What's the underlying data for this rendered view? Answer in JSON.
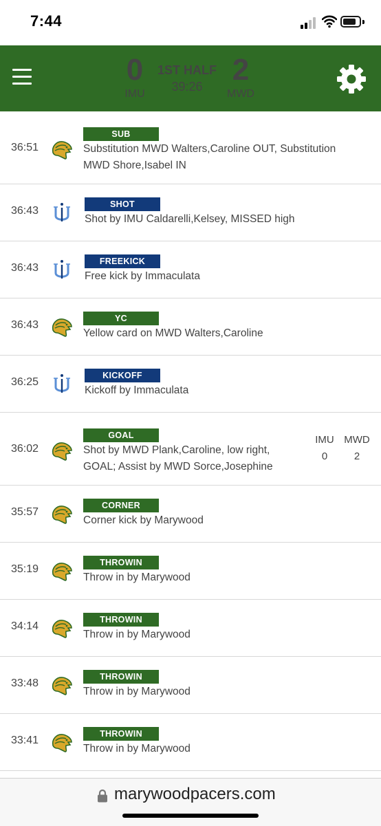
{
  "status_bar": {
    "time": "7:44"
  },
  "header": {
    "home": {
      "score": "0",
      "abbr": "IMU"
    },
    "away": {
      "score": "2",
      "abbr": "MWD"
    },
    "period": "1ST HALF",
    "clock": "39:26"
  },
  "colors": {
    "brand_green": "#2f6b25",
    "badge_navy": "#123a7a",
    "logo_gold": "#d9a82b"
  },
  "plays": [
    {
      "time": "36:51",
      "team": "marywood",
      "type": "SUB",
      "lines": [
        "Substitution MWD Walters,Caroline OUT, Substitution",
        "MWD Shore,Isabel IN"
      ]
    },
    {
      "time": "36:43",
      "team": "immaculata",
      "type": "SHOT",
      "lines": [
        "Shot by IMU Caldarelli,Kelsey, MISSED high"
      ]
    },
    {
      "time": "36:43",
      "team": "immaculata",
      "type": "FREEKICK",
      "lines": [
        "Free kick by Immaculata"
      ]
    },
    {
      "time": "36:43",
      "team": "marywood",
      "type": "YC",
      "lines": [
        "Yellow card on MWD Walters,Caroline"
      ]
    },
    {
      "time": "36:25",
      "team": "immaculata",
      "type": "KICKOFF",
      "lines": [
        "Kickoff by Immaculata"
      ]
    },
    {
      "time": "36:02",
      "team": "marywood",
      "type": "GOAL",
      "lines": [
        "Shot by MWD Plank,Caroline, low right,",
        "GOAL; Assist by MWD Sorce,Josephine"
      ],
      "score": {
        "home_label": "IMU",
        "away_label": "MWD",
        "home": "0",
        "away": "2"
      }
    },
    {
      "time": "35:57",
      "team": "marywood",
      "type": "CORNER",
      "lines": [
        "Corner kick by Marywood"
      ]
    },
    {
      "time": "35:19",
      "team": "marywood",
      "type": "THROWIN",
      "lines": [
        "Throw in by Marywood"
      ]
    },
    {
      "time": "34:14",
      "team": "marywood",
      "type": "THROWIN",
      "lines": [
        "Throw in by Marywood"
      ]
    },
    {
      "time": "33:48",
      "team": "marywood",
      "type": "THROWIN",
      "lines": [
        "Throw in by Marywood"
      ]
    },
    {
      "time": "33:41",
      "team": "marywood",
      "type": "THROWIN",
      "lines": [
        "Throw in by Marywood"
      ]
    }
  ],
  "browser": {
    "url": "marywoodpacers.com"
  }
}
